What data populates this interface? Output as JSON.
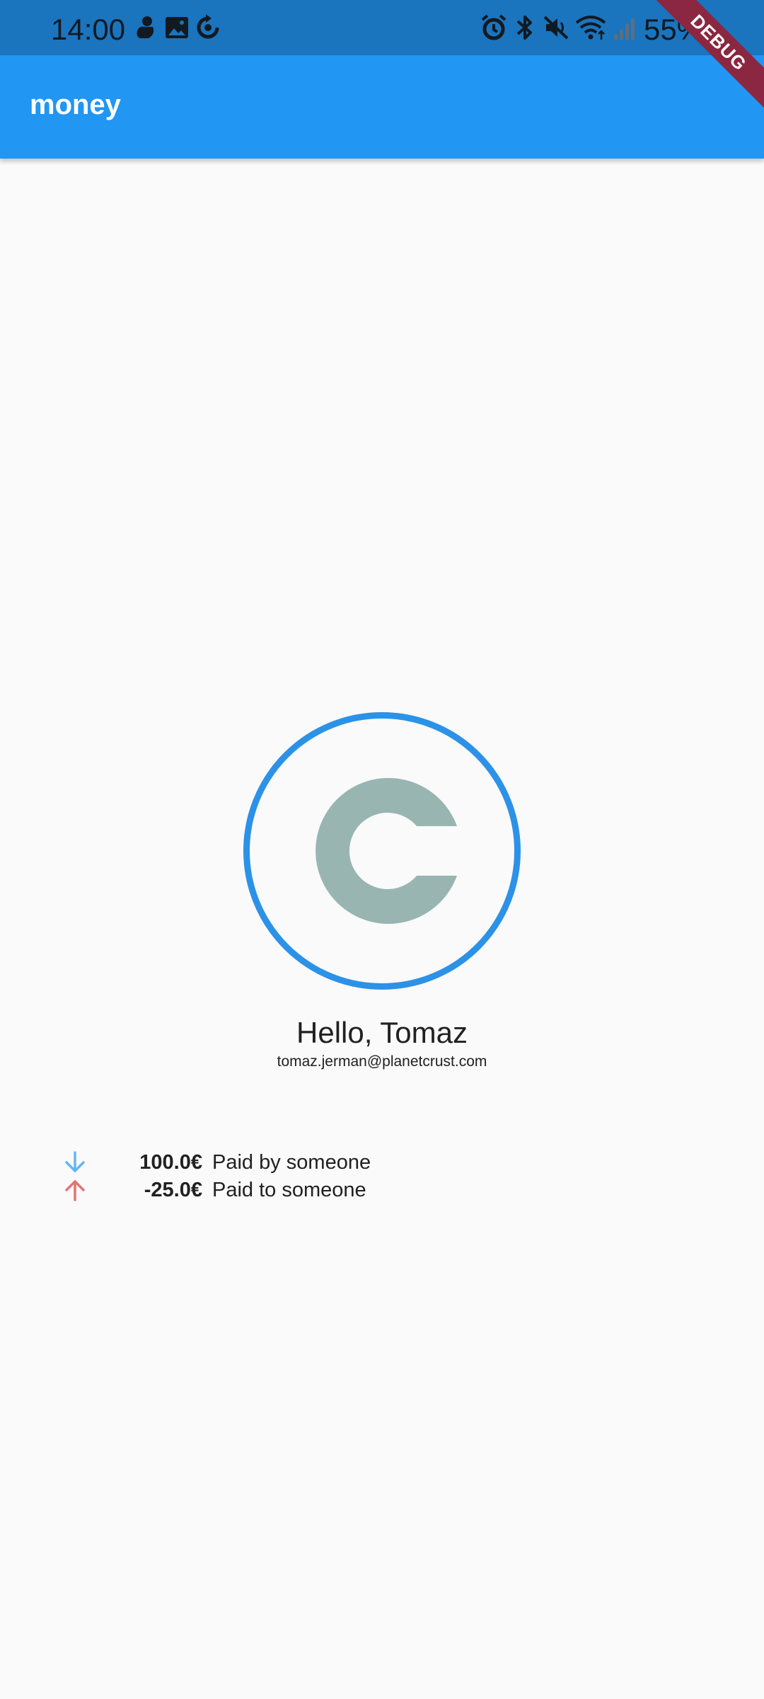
{
  "status_bar": {
    "time": "14:00",
    "battery": "55%",
    "left_icons": [
      "duck-notification-icon",
      "image-icon",
      "sync-icon"
    ],
    "right_icons": [
      "alarm-icon",
      "bluetooth-icon",
      "mute-icon",
      "wifi-icon",
      "signal-icon",
      "battery-icon"
    ]
  },
  "app_bar": {
    "title": "money"
  },
  "debug_banner": {
    "label": "DEBUG"
  },
  "profile": {
    "avatar_icon": "copyright-c-icon",
    "greeting": "Hello, Tomaz",
    "email": "tomaz.jerman@planetcrust.com"
  },
  "transactions": [
    {
      "direction": "in",
      "icon": "arrow-down-icon",
      "icon_color": "#64b5f6",
      "amount": "100.0€",
      "description": "Paid by someone"
    },
    {
      "direction": "out",
      "icon": "arrow-up-icon",
      "icon_color": "#e57373",
      "amount": "-25.0€",
      "description": "Paid to someone"
    }
  ],
  "colors": {
    "status_bar": "#1b74be",
    "app_bar": "#2196f3",
    "background": "#fafafa",
    "avatar_ring": "#2b92e8",
    "avatar_glyph": "#98b5b1",
    "debug_ribbon": "#8b2740"
  }
}
